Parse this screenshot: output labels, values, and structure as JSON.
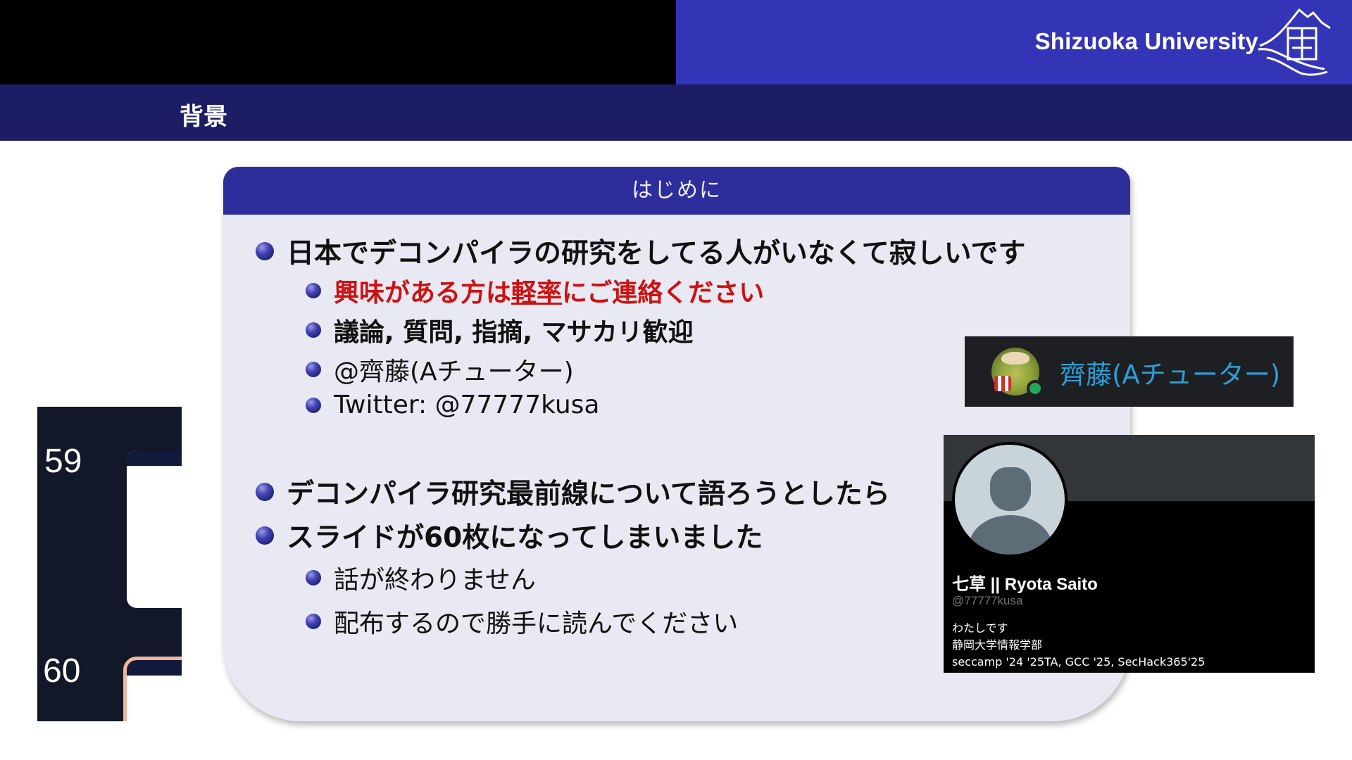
{
  "header": {
    "university_name": "Shizuoka University",
    "slide_title": "背景"
  },
  "block": {
    "title": "はじめに",
    "item1": "日本でデコンパイラの研究をしてる人がいなくて寂しいです",
    "sub1_pre": "興味がある方は",
    "sub1_ul": "軽率",
    "sub1_post": "にご連絡ください",
    "sub2": "議論, 質問, 指摘, マサカリ歓迎",
    "sub3": "@齊藤(Aチューター)",
    "sub4": "Twitter: @77777kusa",
    "item2": "デコンパイラ研究最前線について語ろうとしたら",
    "item3": "スライドが60枚になってしまいました",
    "sub5": "話が終わりません",
    "sub6": "配布するので勝手に読んでください"
  },
  "thumbnails": [
    {
      "number": "59",
      "selected": false
    },
    {
      "number": "60",
      "selected": true
    }
  ],
  "discord_badge": {
    "name": "齊藤(Aチューター)",
    "status": "online",
    "name_color": "#2d9ed6"
  },
  "profile": {
    "display_name": "七草 || Ryota Saito",
    "handle": "@77777kusa",
    "bio_line1": "わたしです",
    "bio_line2": "静岡大学情報学部",
    "bio_line3": "seccamp '24 '25TA, GCC '25, SecHack365'25"
  },
  "colors": {
    "header_blue": "#3434b6",
    "title_band": "#1d1d66",
    "block_head": "#2d2d9c",
    "block_body": "#e9e9f3",
    "highlight_red": "#cc1111"
  }
}
